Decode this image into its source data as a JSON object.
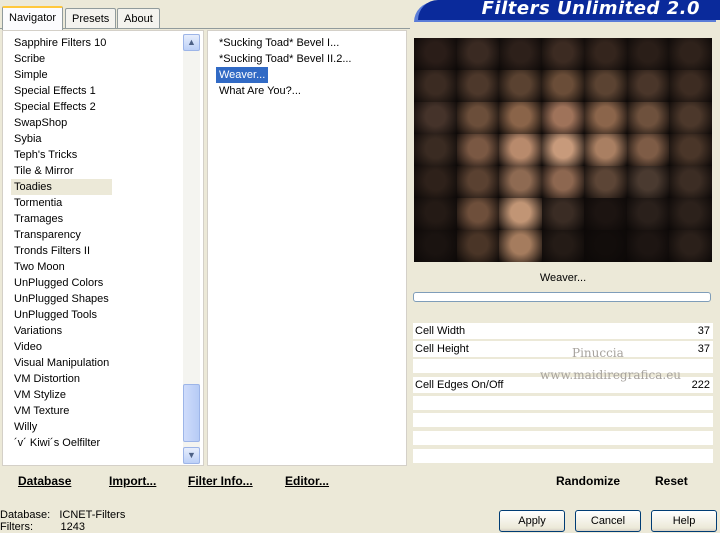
{
  "tabs": [
    "Navigator",
    "Presets",
    "About"
  ],
  "title": "Filters Unlimited 2.0",
  "categories": [
    "Sapphire Filters 10",
    "Scribe",
    "Simple",
    "Special Effects 1",
    "Special Effects 2",
    "SwapShop",
    "Sybia",
    "Teph's Tricks",
    "Tile & Mirror",
    "Toadies",
    "Tormentia",
    "Tramages",
    "Transparency",
    "Tronds Filters II",
    "Two Moon",
    "UnPlugged Colors",
    "UnPlugged Shapes",
    "UnPlugged Tools",
    "Variations",
    "Video",
    "Visual Manipulation",
    "VM Distortion",
    "VM Stylize",
    "VM Texture",
    "Willy",
    "´v´ Kiwi´s Oelfilter"
  ],
  "selected_category": "Toadies",
  "filters": [
    "*Sucking Toad*  Bevel I...",
    "*Sucking Toad*  Bevel II.2...",
    "Weaver...",
    "What Are You?..."
  ],
  "selected_filter": "Weaver...",
  "preview_title": "Weaver...",
  "progress": 0,
  "params": [
    {
      "label": "Cell Width",
      "value": "37"
    },
    {
      "label": "Cell Height",
      "value": "37"
    },
    {
      "label": "Cell Edges On/Off",
      "value": "222"
    }
  ],
  "watermark": {
    "line1": "Pinuccia",
    "line2": "www.maidiregrafica.eu"
  },
  "bottom_links": {
    "database": "Database",
    "import": "Import...",
    "filter_info": "Filter Info...",
    "editor": "Editor...",
    "randomize": "Randomize",
    "reset": "Reset"
  },
  "buttons": {
    "apply": "Apply",
    "cancel": "Cancel",
    "help": "Help"
  },
  "status": {
    "database_label": "Database:",
    "database_value": "ICNET-Filters",
    "filters_label": "Filters:",
    "filters_value": "1243"
  },
  "colors": {
    "selection_blue": "#316ac5",
    "banner_blue": "#0a2a9b",
    "window_bg": "#ece9d8"
  },
  "icons": [
    "scroll-up-arrow-icon",
    "scroll-down-arrow-icon"
  ]
}
